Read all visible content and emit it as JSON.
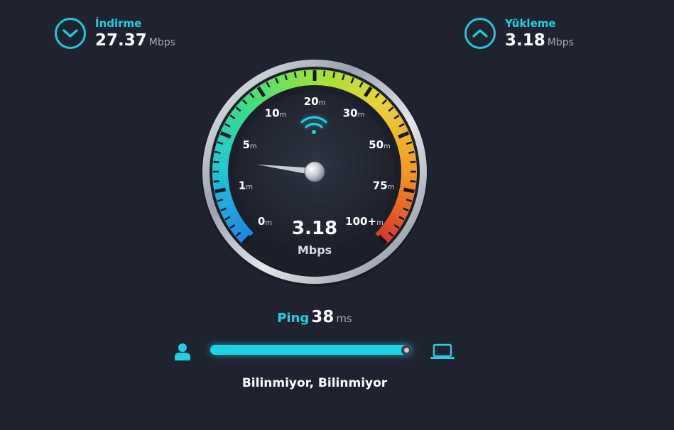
{
  "download": {
    "label": "İndirme",
    "value": "27.37",
    "unit": "Mbps",
    "icon": "chevron-down-icon"
  },
  "upload": {
    "label": "Yükleme",
    "value": "3.18",
    "unit": "Mbps",
    "icon": "chevron-up-icon"
  },
  "gauge": {
    "scale_labels": [
      {
        "num": "0",
        "sub": "m"
      },
      {
        "num": "1",
        "sub": "m"
      },
      {
        "num": "5",
        "sub": "m"
      },
      {
        "num": "10",
        "sub": "m"
      },
      {
        "num": "20",
        "sub": "m"
      },
      {
        "num": "30",
        "sub": "m"
      },
      {
        "num": "50",
        "sub": "m"
      },
      {
        "num": "75",
        "sub": "m"
      },
      {
        "num": "100+",
        "sub": "m"
      }
    ],
    "current_value": "3.18",
    "current_unit": "Mbps",
    "needle_value": 3.18,
    "icon": "wifi-icon"
  },
  "ping": {
    "label": "Ping",
    "value": "38",
    "unit": "ms",
    "progress_fraction": 1.0
  },
  "isp": {
    "text": "Bilinmiyor, Bilinmiyor"
  },
  "colors": {
    "accent": "#20d0e0",
    "background": "#1f2330",
    "gauge_gradient": [
      "#1e88e5",
      "#22c7d8",
      "#3ddc84",
      "#9be33a",
      "#e8d23a",
      "#f29a22",
      "#d93a2f"
    ]
  }
}
